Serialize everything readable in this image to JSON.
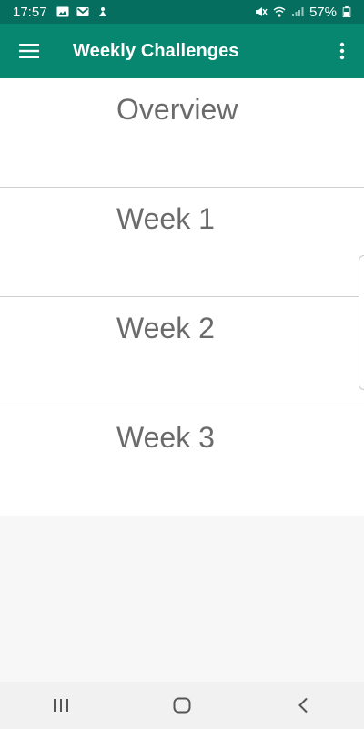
{
  "status_bar": {
    "time": "17:57",
    "battery": "57%",
    "icons_left": [
      "image-icon",
      "gmail-icon",
      "notification-icon"
    ],
    "icons_right": [
      "mute-icon",
      "wifi-icon",
      "signal-icon",
      "battery-icon"
    ]
  },
  "app_bar": {
    "title": "Weekly Challenges",
    "menu_icon": "hamburger-menu-icon",
    "more_icon": "more-vert-icon",
    "color": "#078770",
    "status_color": "#056e5f"
  },
  "list": {
    "items": [
      {
        "label": "Overview"
      },
      {
        "label": "Week 1"
      },
      {
        "label": "Week 2"
      },
      {
        "label": "Week 3"
      }
    ]
  },
  "nav_bar": {
    "buttons": [
      "recents-icon",
      "home-icon",
      "back-icon"
    ]
  }
}
